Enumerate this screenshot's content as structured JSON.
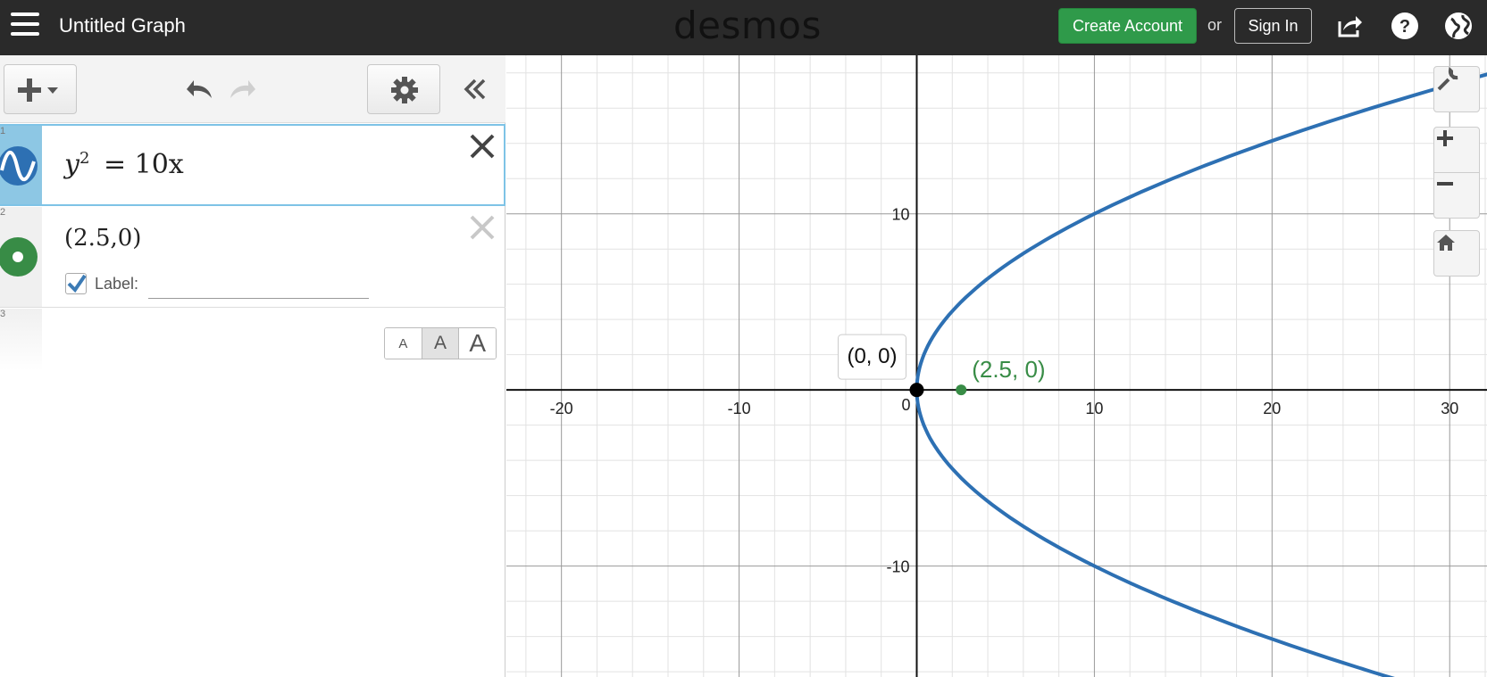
{
  "header": {
    "title": "Untitled Graph",
    "brand": "desmos",
    "create_account": "Create Account",
    "or": "or",
    "sign_in": "Sign In"
  },
  "expressions": [
    {
      "index": "1",
      "latex_base": "y",
      "latex_sup": "2",
      "latex_rest": "= 10x",
      "color": "#2d70b3"
    },
    {
      "index": "2",
      "text": "(2.5,0)",
      "label_caption": "Label:",
      "label_value": "",
      "sizes": [
        "A",
        "A",
        "A"
      ],
      "selected_size": 1,
      "color": "#388c46"
    },
    {
      "index": "3"
    }
  ],
  "graph": {
    "x_ticks": [
      "-20",
      "-10",
      "10",
      "20",
      "30"
    ],
    "y_ticks": [
      "10",
      "-10"
    ],
    "origin_label": "0",
    "point_labels": {
      "vertex": "(0, 0)",
      "focus": "(2.5, 0)"
    },
    "curve_color": "#2d70b3",
    "focus_color": "#388c46"
  },
  "chart_data": {
    "type": "line",
    "series": [
      {
        "values": [
          [
            0,
            0
          ],
          [
            2.5,
            5
          ],
          [
            10,
            10
          ],
          [
            22.5,
            15
          ],
          [
            32,
            17.9
          ],
          [
            2.5,
            -5
          ],
          [
            10,
            -10
          ],
          [
            22.5,
            -15
          ],
          [
            32,
            -17.9
          ]
        ]
      }
    ],
    "points": [
      {
        "x": 0,
        "y": 0,
        "label": "(0, 0)"
      },
      {
        "x": 2.5,
        "y": 0,
        "label": "(2.5, 0)"
      }
    ],
    "xlim": [
      -23.1,
      32.1
    ],
    "ylim": [
      -16.3,
      19
    ],
    "grid": true
  }
}
